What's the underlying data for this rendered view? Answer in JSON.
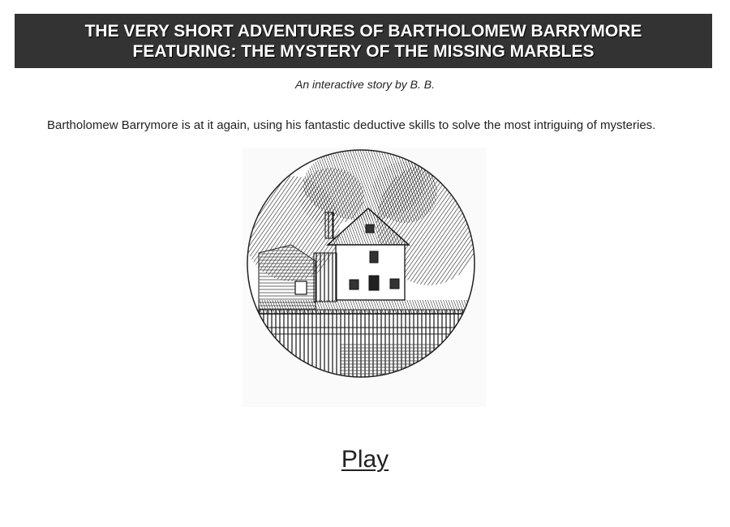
{
  "header": {
    "title_line_1": "THE VERY SHORT ADVENTURES OF BARTHOLOMEW BARRYMORE",
    "title_line_2": "FEATURING: THE MYSTERY OF THE MISSING MARBLES"
  },
  "byline": "An interactive story by B. B.",
  "intro": "Bartholomew Barrymore is at it again, using his fantastic deductive skills to solve the most intriguing of mysteries.",
  "illustration": {
    "subject": "house-among-trees-engraving"
  },
  "play_link": "Play",
  "colors": {
    "header_bg": "#333333",
    "header_text": "#ffffff",
    "body_text": "#222222"
  }
}
